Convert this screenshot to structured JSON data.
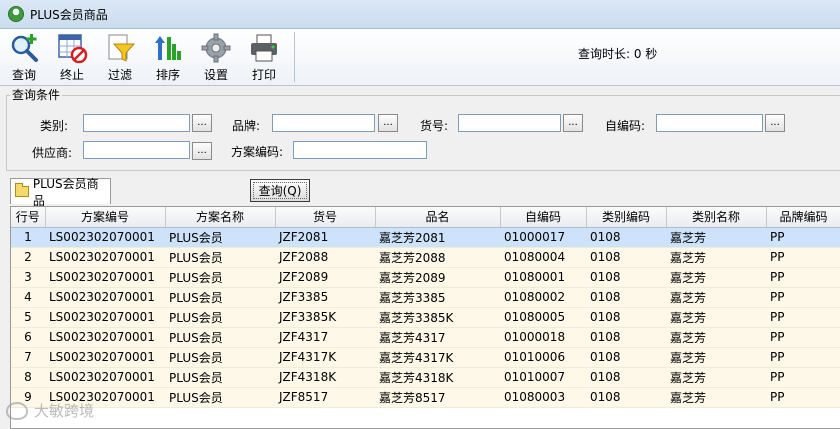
{
  "window": {
    "title": "PLUS会员商品"
  },
  "toolbar": {
    "buttons": [
      {
        "label": "查询",
        "icon": "search-add-icon"
      },
      {
        "label": "终止",
        "icon": "stop-table-icon"
      },
      {
        "label": "过滤",
        "icon": "filter-funnel-icon"
      },
      {
        "label": "排序",
        "icon": "sort-icon"
      },
      {
        "label": "设置",
        "icon": "gear-icon"
      },
      {
        "label": "打印",
        "icon": "printer-icon"
      }
    ],
    "query_time": "查询时长: 0 秒"
  },
  "conditions": {
    "legend": "查询条件",
    "category_label": "类别:",
    "brand_label": "品牌:",
    "item_no_label": "货号:",
    "self_code_label": "自编码:",
    "supplier_label": "供应商:",
    "plan_code_label": "方案编码:",
    "browse_btn": "...",
    "category_value": "",
    "brand_value": "",
    "item_no_value": "",
    "self_code_value": "",
    "supplier_value": "",
    "plan_code_value": ""
  },
  "tab": {
    "label": "PLUS会员商品"
  },
  "query_button": "查询(Q)",
  "table": {
    "columns": [
      "行号",
      "方案编号",
      "方案名称",
      "货号",
      "品名",
      "自编码",
      "类别编码",
      "类别名称",
      "品牌编码"
    ],
    "rows": [
      [
        "1",
        "LS002302070001",
        "PLUS会员",
        "JZF2081",
        "嘉芝芳2081",
        "01000017",
        "0108",
        "嘉芝芳",
        "PP"
      ],
      [
        "2",
        "LS002302070001",
        "PLUS会员",
        "JZF2088",
        "嘉芝芳2088",
        "01080004",
        "0108",
        "嘉芝芳",
        "PP"
      ],
      [
        "3",
        "LS002302070001",
        "PLUS会员",
        "JZF2089",
        "嘉芝芳2089",
        "01080001",
        "0108",
        "嘉芝芳",
        "PP"
      ],
      [
        "4",
        "LS002302070001",
        "PLUS会员",
        "JZF3385",
        "嘉芝芳3385",
        "01080002",
        "0108",
        "嘉芝芳",
        "PP"
      ],
      [
        "5",
        "LS002302070001",
        "PLUS会员",
        "JZF3385K",
        "嘉芝芳3385K",
        "01080005",
        "0108",
        "嘉芝芳",
        "PP"
      ],
      [
        "6",
        "LS002302070001",
        "PLUS会员",
        "JZF4317",
        "嘉芝芳4317",
        "01000018",
        "0108",
        "嘉芝芳",
        "PP"
      ],
      [
        "7",
        "LS002302070001",
        "PLUS会员",
        "JZF4317K",
        "嘉芝芳4317K",
        "01010006",
        "0108",
        "嘉芝芳",
        "PP"
      ],
      [
        "8",
        "LS002302070001",
        "PLUS会员",
        "JZF4318K",
        "嘉芝芳4318K",
        "01010007",
        "0108",
        "嘉芝芳",
        "PP"
      ],
      [
        "9",
        "LS002302070001",
        "PLUS会员",
        "JZF8517",
        "嘉芝芳8517",
        "01080003",
        "0108",
        "嘉芝芳",
        "PP"
      ]
    ],
    "selected_row": 1
  },
  "watermark": "大敏跨境"
}
